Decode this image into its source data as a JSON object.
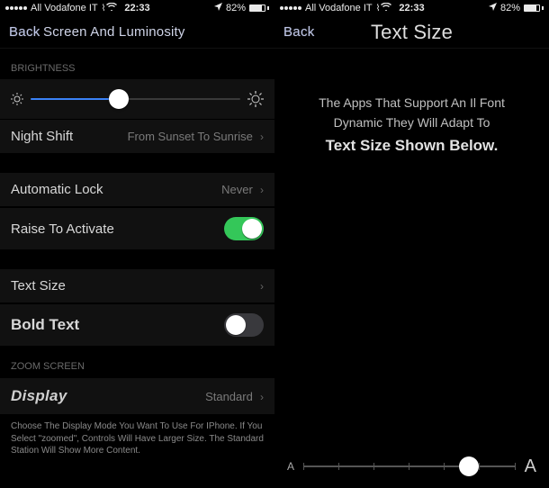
{
  "status": {
    "carrier": "All Vodafone IT",
    "time": "22:33",
    "battery": "82%"
  },
  "left": {
    "nav": {
      "back": "Back",
      "title": "Screen And Luminosity"
    },
    "brightnessLabel": "BRIGHTNESS",
    "brightnessPercent": 42,
    "nightShift": {
      "label": "Night Shift",
      "value": "From Sunset To Sunrise"
    },
    "autoLock": {
      "label": "Automatic Lock",
      "value": "Never"
    },
    "raise": {
      "label": "Raise To Activate"
    },
    "textSize": {
      "label": "Text Size"
    },
    "boldText": {
      "label": "Bold Text"
    },
    "zoomLabel": "ZOOM SCREEN",
    "display": {
      "label": "Display",
      "value": "Standard"
    },
    "footer": "Choose The Display Mode You Want To Use For IPhone. If You Select \"zoomed\", Controls Will Have Larger Size. The Standard Station Will Show More Content."
  },
  "right": {
    "nav": {
      "back": "Back",
      "title": "Text Size"
    },
    "desc": {
      "line1": "The Apps That Support An Il Font",
      "line2": "Dynamic They Will Adapt To",
      "line3": "Text Size Shown Below."
    },
    "sizeSmall": "A",
    "sizeLarge": "A",
    "sizePercent": 78
  }
}
